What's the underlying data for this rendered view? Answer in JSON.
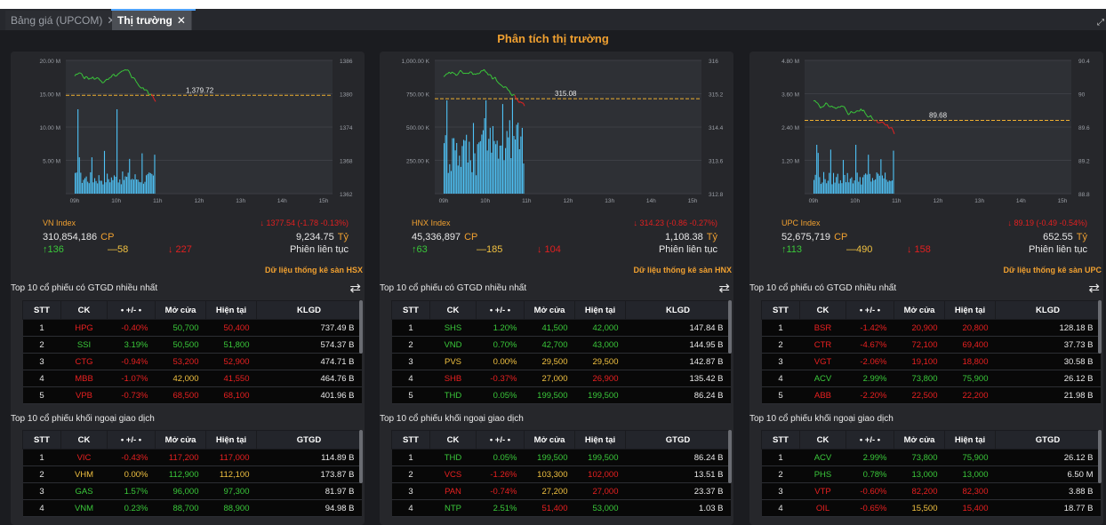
{
  "tabs": [
    {
      "label": "Bảng giá (UPCOM)",
      "close": "✕",
      "active": false
    },
    {
      "label": "Thị trường",
      "close": "✕",
      "active": true
    }
  ],
  "page_title": "Phân tích thị trường",
  "panels": [
    {
      "chart": {
        "vol_ticks": [
          "20.00 M",
          "15.00 M",
          "10.00 M",
          "5.00 M"
        ],
        "price_ticks": [
          "1386",
          "1380",
          "1374",
          "1368",
          "1362"
        ],
        "time_ticks": [
          "09h",
          "10h",
          "11h",
          "12h",
          "13h",
          "14h",
          "15h"
        ],
        "ref_label": "1,379.72",
        "ref_value": 1379.72,
        "price_range": [
          1362,
          1386
        ],
        "vol_max": 20
      },
      "index_name": "VN Index",
      "index_change": "↓ 1377.54  (-1.78  -0.13%)",
      "volume": "310,854,186",
      "volume_unit": "CP",
      "value": "9,234.75",
      "value_unit": "Tỷ",
      "advances": "↑136",
      "unchanged": "—58",
      "declines": "↓ 227",
      "session": "Phiên liên tục",
      "stats_link": "Dữ liệu thống kê sàn HSX",
      "top_gtgd_title": "Top 10 cổ phiếu có GTGD nhiều nhất",
      "top_foreign_title": "Top 10 cổ phiếu khối ngoại giao dịch",
      "table1_headers": [
        "STT",
        "CK",
        "• +/- •",
        "Mở cửa",
        "Hiện tại",
        "KLGD"
      ],
      "table1_rows": [
        {
          "stt": "1",
          "ck": "HPG",
          "chg": "-0.40%",
          "open": "50,700",
          "cur": "50,400",
          "vol": "737.49 B",
          "c": "down",
          "oc": "up"
        },
        {
          "stt": "2",
          "ck": "SSI",
          "chg": "3.19%",
          "open": "50,500",
          "cur": "51,800",
          "vol": "574.37 B",
          "c": "up",
          "oc": "up"
        },
        {
          "stt": "3",
          "ck": "CTG",
          "chg": "-0.94%",
          "open": "53,200",
          "cur": "52,900",
          "vol": "474.71 B",
          "c": "down",
          "oc": "down"
        },
        {
          "stt": "4",
          "ck": "MBB",
          "chg": "-1.07%",
          "open": "42,000",
          "cur": "41,550",
          "vol": "464.76 B",
          "c": "down",
          "oc": "ref"
        },
        {
          "stt": "5",
          "ck": "VPB",
          "chg": "-0.73%",
          "open": "68,500",
          "cur": "68,100",
          "vol": "401.96 B",
          "c": "down",
          "oc": "down"
        }
      ],
      "table2_headers": [
        "STT",
        "CK",
        "• +/- •",
        "Mở cửa",
        "Hiện tại",
        "GTGD"
      ],
      "table2_rows": [
        {
          "stt": "1",
          "ck": "VIC",
          "chg": "-0.43%",
          "open": "117,200",
          "cur": "117,000",
          "vol": "114.89 B",
          "c": "down",
          "oc": "down"
        },
        {
          "stt": "2",
          "ck": "VHM",
          "chg": "0.00%",
          "open": "112,900",
          "cur": "112,100",
          "vol": "173.87 B",
          "c": "ref",
          "oc": "up"
        },
        {
          "stt": "3",
          "ck": "GAS",
          "chg": "1.57%",
          "open": "96,000",
          "cur": "97,300",
          "vol": "81.97 B",
          "c": "up",
          "oc": "up"
        },
        {
          "stt": "4",
          "ck": "VNM",
          "chg": "0.23%",
          "open": "88,700",
          "cur": "88,900",
          "vol": "94.98 B",
          "c": "up",
          "oc": "up"
        }
      ]
    },
    {
      "chart": {
        "vol_ticks": [
          "1,000.00 K",
          "750.00 K",
          "500.00 K",
          "250.00 K"
        ],
        "price_ticks": [
          "316",
          "315.2",
          "314.4",
          "313.6",
          "312.8"
        ],
        "time_ticks": [
          "09h",
          "10h",
          "11h",
          "12h",
          "13h",
          "14h",
          "15h"
        ],
        "ref_label": "315.08",
        "ref_value": 315.08,
        "price_range": [
          312.8,
          316
        ],
        "vol_max": 1000
      },
      "index_name": "HNX Index",
      "index_change": "↓ 314.23  (-0.86  -0.27%)",
      "volume": "45,336,897",
      "volume_unit": "CP",
      "value": "1,108.38",
      "value_unit": "Tỷ",
      "advances": "↑63",
      "unchanged": "—185",
      "declines": "↓ 104",
      "session": "Phiên liên tục",
      "stats_link": "Dữ liệu thống kê sàn HNX",
      "top_gtgd_title": "Top 10 cổ phiếu có GTGD nhiều nhất",
      "top_foreign_title": "Top 10 cổ phiếu khối ngoại giao dịch",
      "table1_headers": [
        "STT",
        "CK",
        "• +/- •",
        "Mở cửa",
        "Hiện tại",
        "KLGD"
      ],
      "table1_rows": [
        {
          "stt": "1",
          "ck": "SHS",
          "chg": "1.20%",
          "open": "41,500",
          "cur": "42,000",
          "vol": "147.84 B",
          "c": "up",
          "oc": "up"
        },
        {
          "stt": "2",
          "ck": "VND",
          "chg": "0.70%",
          "open": "42,700",
          "cur": "43,000",
          "vol": "144.95 B",
          "c": "up",
          "oc": "up"
        },
        {
          "stt": "3",
          "ck": "PVS",
          "chg": "0.00%",
          "open": "29,500",
          "cur": "29,500",
          "vol": "142.87 B",
          "c": "ref",
          "oc": "ref"
        },
        {
          "stt": "4",
          "ck": "SHB",
          "chg": "-0.37%",
          "open": "27,000",
          "cur": "26,900",
          "vol": "135.42 B",
          "c": "down",
          "oc": "ref"
        },
        {
          "stt": "5",
          "ck": "THD",
          "chg": "0.05%",
          "open": "199,500",
          "cur": "199,500",
          "vol": "86.24 B",
          "c": "up",
          "oc": "up"
        }
      ],
      "table2_headers": [
        "STT",
        "CK",
        "• +/- •",
        "Mở cửa",
        "Hiện tại",
        "GTGD"
      ],
      "table2_rows": [
        {
          "stt": "1",
          "ck": "THD",
          "chg": "0.05%",
          "open": "199,500",
          "cur": "199,500",
          "vol": "86.24 B",
          "c": "up",
          "oc": "up"
        },
        {
          "stt": "2",
          "ck": "VCS",
          "chg": "-1.26%",
          "open": "103,300",
          "cur": "102,000",
          "vol": "13.51 B",
          "c": "down",
          "oc": "ref"
        },
        {
          "stt": "3",
          "ck": "PAN",
          "chg": "-0.74%",
          "open": "27,200",
          "cur": "27,000",
          "vol": "23.37 B",
          "c": "down",
          "oc": "ref"
        },
        {
          "stt": "4",
          "ck": "NTP",
          "chg": "2.51%",
          "open": "51,400",
          "cur": "53,000",
          "vol": "1.03 B",
          "c": "up",
          "oc": "down"
        }
      ]
    },
    {
      "chart": {
        "vol_ticks": [
          "4.80 M",
          "3.60 M",
          "2.40 M",
          "1.20 M"
        ],
        "price_ticks": [
          "90.4",
          "90",
          "89.6",
          "89.2",
          "88.8"
        ],
        "time_ticks": [
          "09h",
          "10h",
          "11h",
          "12h",
          "13h",
          "14h",
          "15h"
        ],
        "ref_label": "89.68",
        "ref_value": 89.68,
        "price_range": [
          88.8,
          90.4
        ],
        "vol_max": 4.8
      },
      "index_name": "UPC Index",
      "index_change": "↓ 89.19  (-0.49  -0.54%)",
      "volume": "52,675,719",
      "volume_unit": "CP",
      "value": "652.55",
      "value_unit": "Tỷ",
      "advances": "↑113",
      "unchanged": "—490",
      "declines": "↓ 158",
      "session": "Phiên liên tục",
      "stats_link": "Dữ liệu thống kê sàn UPC",
      "top_gtgd_title": "Top 10 cổ phiếu có GTGD nhiều nhất",
      "top_foreign_title": "Top 10 cổ phiếu khối ngoại giao dịch",
      "table1_headers": [
        "STT",
        "CK",
        "• +/- •",
        "Mở cửa",
        "Hiện tại",
        "KLGD"
      ],
      "table1_rows": [
        {
          "stt": "1",
          "ck": "BSR",
          "chg": "-1.42%",
          "open": "20,900",
          "cur": "20,800",
          "vol": "128.18 B",
          "c": "down",
          "oc": "down"
        },
        {
          "stt": "2",
          "ck": "CTR",
          "chg": "-4.67%",
          "open": "72,100",
          "cur": "69,400",
          "vol": "37.73 B",
          "c": "down",
          "oc": "down"
        },
        {
          "stt": "3",
          "ck": "VGT",
          "chg": "-2.06%",
          "open": "19,100",
          "cur": "18,800",
          "vol": "30.58 B",
          "c": "down",
          "oc": "down"
        },
        {
          "stt": "4",
          "ck": "ACV",
          "chg": "2.99%",
          "open": "73,800",
          "cur": "75,900",
          "vol": "26.12 B",
          "c": "up",
          "oc": "up"
        },
        {
          "stt": "5",
          "ck": "ABB",
          "chg": "-2.20%",
          "open": "22,500",
          "cur": "22,200",
          "vol": "21.98 B",
          "c": "down",
          "oc": "down"
        }
      ],
      "table2_headers": [
        "STT",
        "CK",
        "• +/- •",
        "Mở cửa",
        "Hiện tại",
        "GTGD"
      ],
      "table2_rows": [
        {
          "stt": "1",
          "ck": "ACV",
          "chg": "2.99%",
          "open": "73,800",
          "cur": "75,900",
          "vol": "26.12 B",
          "c": "up",
          "oc": "up"
        },
        {
          "stt": "2",
          "ck": "PHS",
          "chg": "0.78%",
          "open": "13,000",
          "cur": "13,000",
          "vol": "6.50 M",
          "c": "up",
          "oc": "up"
        },
        {
          "stt": "3",
          "ck": "VTP",
          "chg": "-0.60%",
          "open": "82,200",
          "cur": "82,300",
          "vol": "3.88 B",
          "c": "down",
          "oc": "down"
        },
        {
          "stt": "4",
          "ck": "OIL",
          "chg": "-0.65%",
          "open": "15,500",
          "cur": "15,400",
          "vol": "18.77 B",
          "c": "down",
          "oc": "ref"
        }
      ]
    }
  ],
  "colors": {
    "up": "#3ac83a",
    "down": "#e82020",
    "ref": "#f0c040",
    "accent": "#f0a030",
    "volume": "#4fc3f7"
  },
  "icons": {
    "tab_close": "close-icon",
    "swap": "swap-arrows-icon",
    "resize": "resize-icon"
  }
}
